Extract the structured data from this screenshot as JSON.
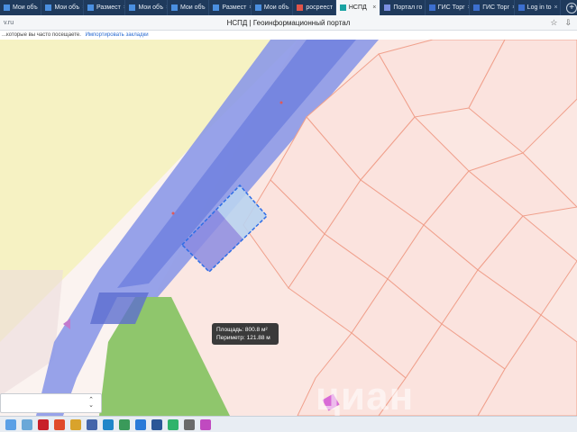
{
  "browser": {
    "tabs": [
      {
        "label": "Мои объ",
        "color": "#4a8fe0"
      },
      {
        "label": "Мои объ",
        "color": "#4a8fe0"
      },
      {
        "label": "Размест",
        "color": "#4a8fe0"
      },
      {
        "label": "Мои объ",
        "color": "#4a8fe0"
      },
      {
        "label": "Мои объ",
        "color": "#4a8fe0"
      },
      {
        "label": "Размест",
        "color": "#4a8fe0"
      },
      {
        "label": "Мои объ",
        "color": "#4a8fe0"
      },
      {
        "label": "росреест",
        "color": "#e0544a"
      },
      {
        "label": "НСПД",
        "color": "#1aa3a3"
      },
      {
        "label": "Портал го",
        "color": "#7a8fe0"
      },
      {
        "label": "ГИС Торг",
        "color": "#3c6fcf"
      },
      {
        "label": "ГИС Торг",
        "color": "#3c6fcf"
      },
      {
        "label": "Log in to",
        "color": "#3c6fcf"
      }
    ],
    "active_tab_index": 8,
    "close_glyph": "×",
    "new_tab_glyph": "+",
    "address_left": "v.ru",
    "page_title": "НСПД | Геоинформационный портал",
    "icons_right": [
      "bookmark-icon",
      "download-icon"
    ]
  },
  "bookmarks_bar": {
    "text": "...которые вы часто посещаете.",
    "import_link": "Импортировать закладки"
  },
  "map": {
    "tooltip": {
      "area_label": "Площадь: 800.8 м²",
      "perimeter_label": "Периметр: 121.88 м"
    },
    "watermark": "циан",
    "select_chevron_up": "⌃",
    "select_chevron_down": "⌄",
    "colors": {
      "road": "#8c99e8",
      "road_dark": "#6e7fde",
      "greenery": "#8fc66c",
      "sand": "#f6f2c3",
      "parcel_fill": "#fbe3de",
      "parcel_border": "#f0a08c",
      "selection": "#2e6ee6",
      "marker": "#d86ad6"
    }
  },
  "taskbar": {
    "apps": [
      "weather-icon",
      "search-icon",
      "pdf-icon",
      "yandex-icon",
      "folder-icon",
      "media-icon",
      "edge-icon",
      "chat-icon",
      "mail-icon",
      "word-icon",
      "cube-icon",
      "calc-icon",
      "paint-icon"
    ]
  }
}
